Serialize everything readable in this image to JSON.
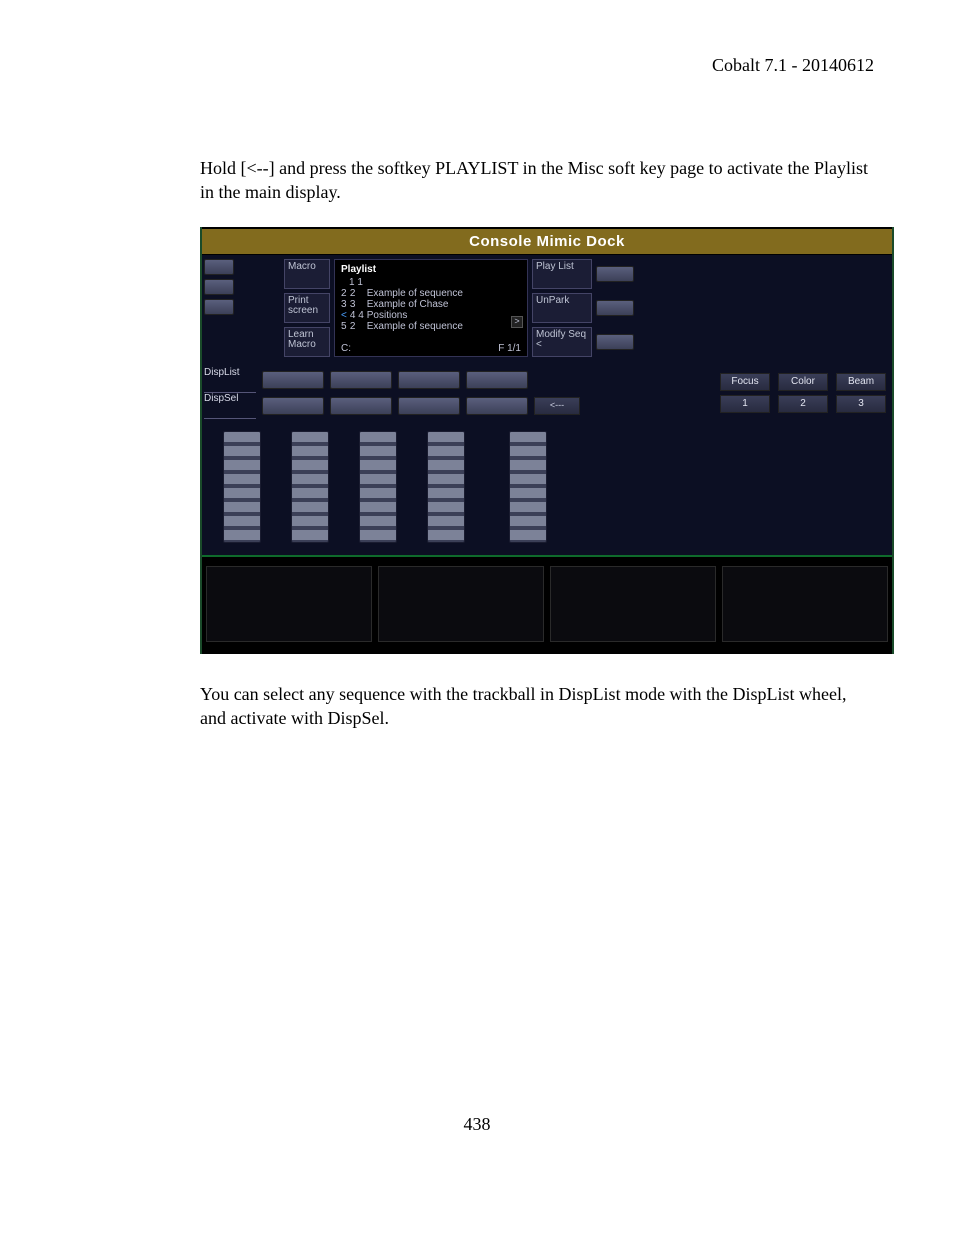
{
  "doc": {
    "header": "Cobalt 7.1 - 20140612",
    "para1": "Hold [<--] and press the softkey PLAYLIST in the Misc soft key page to activate the Playlist in the main display.",
    "para2": "You can select any sequence with the trackball in DispList mode with the DispList wheel, and activate with DispSel.",
    "page_number": "438"
  },
  "mimic": {
    "title": "Console Mimic Dock",
    "left_keys": [
      "Macro",
      "Print screen",
      "Learn Macro"
    ],
    "playlist": {
      "title": "Playlist",
      "current": "1 1",
      "rows": [
        {
          "n": "2",
          "seq": "2",
          "name": "Example of sequence"
        },
        {
          "n": "3",
          "seq": "3",
          "name": "Example of Chase"
        },
        {
          "n": "4",
          "seq": "4",
          "name": "Positions",
          "selected": true
        },
        {
          "n": "5",
          "seq": "2",
          "name": "Example of sequence"
        }
      ],
      "prefix": "<",
      "footer_left": "C:",
      "footer_right": "F 1/1",
      "scroll": ">"
    },
    "right_keys": [
      "Play List",
      "UnPark",
      "Modify Seq <"
    ],
    "disp_labels": {
      "list": "DispList",
      "sel": "DispSel"
    },
    "arrow_label": "<---",
    "param_top": [
      "Focus",
      "Color",
      "Beam"
    ],
    "param_bottom": [
      "1",
      "2",
      "3"
    ]
  }
}
